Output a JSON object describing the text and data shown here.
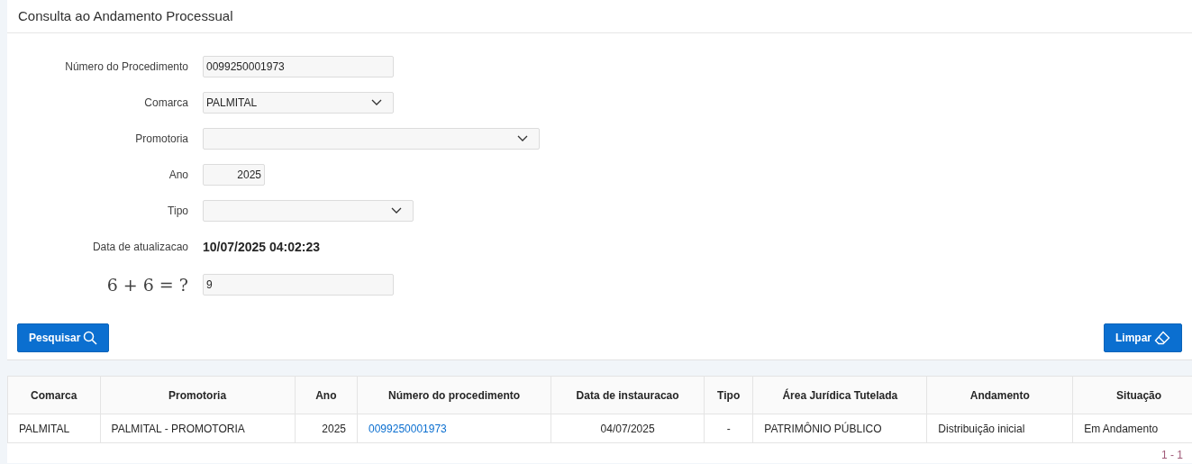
{
  "title": "Consulta ao Andamento Processual",
  "form": [
    {
      "kind": "text",
      "label": "Número do Procedimento",
      "value": "0099250001973"
    },
    {
      "kind": "select",
      "label": "Comarca",
      "value": "PALMITAL"
    },
    {
      "kind": "select",
      "label": "Promotoria"
    },
    {
      "kind": "number",
      "label": "Ano",
      "value": "2025"
    },
    {
      "kind": "select",
      "label": "Tipo"
    },
    {
      "kind": "display",
      "label": "Data de atualizacao",
      "value": "10/07/2025 04:02:23"
    },
    {
      "kind": "captcha",
      "label": "6 + 6 = ?",
      "value": "9"
    }
  ],
  "buttons": [
    {
      "label": "Pesquisar"
    },
    {
      "label": "Limpar"
    }
  ],
  "table": {
    "columns": [
      "Comarca",
      "Promotoria",
      "Ano",
      "Número do procedimento",
      "Data de instauracao",
      "Tipo",
      "Área Jurídica Tutelada",
      "Andamento",
      "Situação"
    ],
    "rows": [
      [
        {
          "text": "PALMITAL"
        },
        {
          "text": "PALMITAL - PROMOTORIA"
        },
        {
          "text": "2025"
        },
        {
          "text": "0099250001973",
          "link": true
        },
        {
          "text": "04/07/2025"
        },
        {
          "text": "-"
        },
        {
          "text": "PATRIMÔNIO PÚBLICO"
        },
        {
          "text": "Distribuição inicial"
        },
        {
          "text": "Em Andamento"
        }
      ]
    ]
  },
  "pagination": "1 - 1"
}
